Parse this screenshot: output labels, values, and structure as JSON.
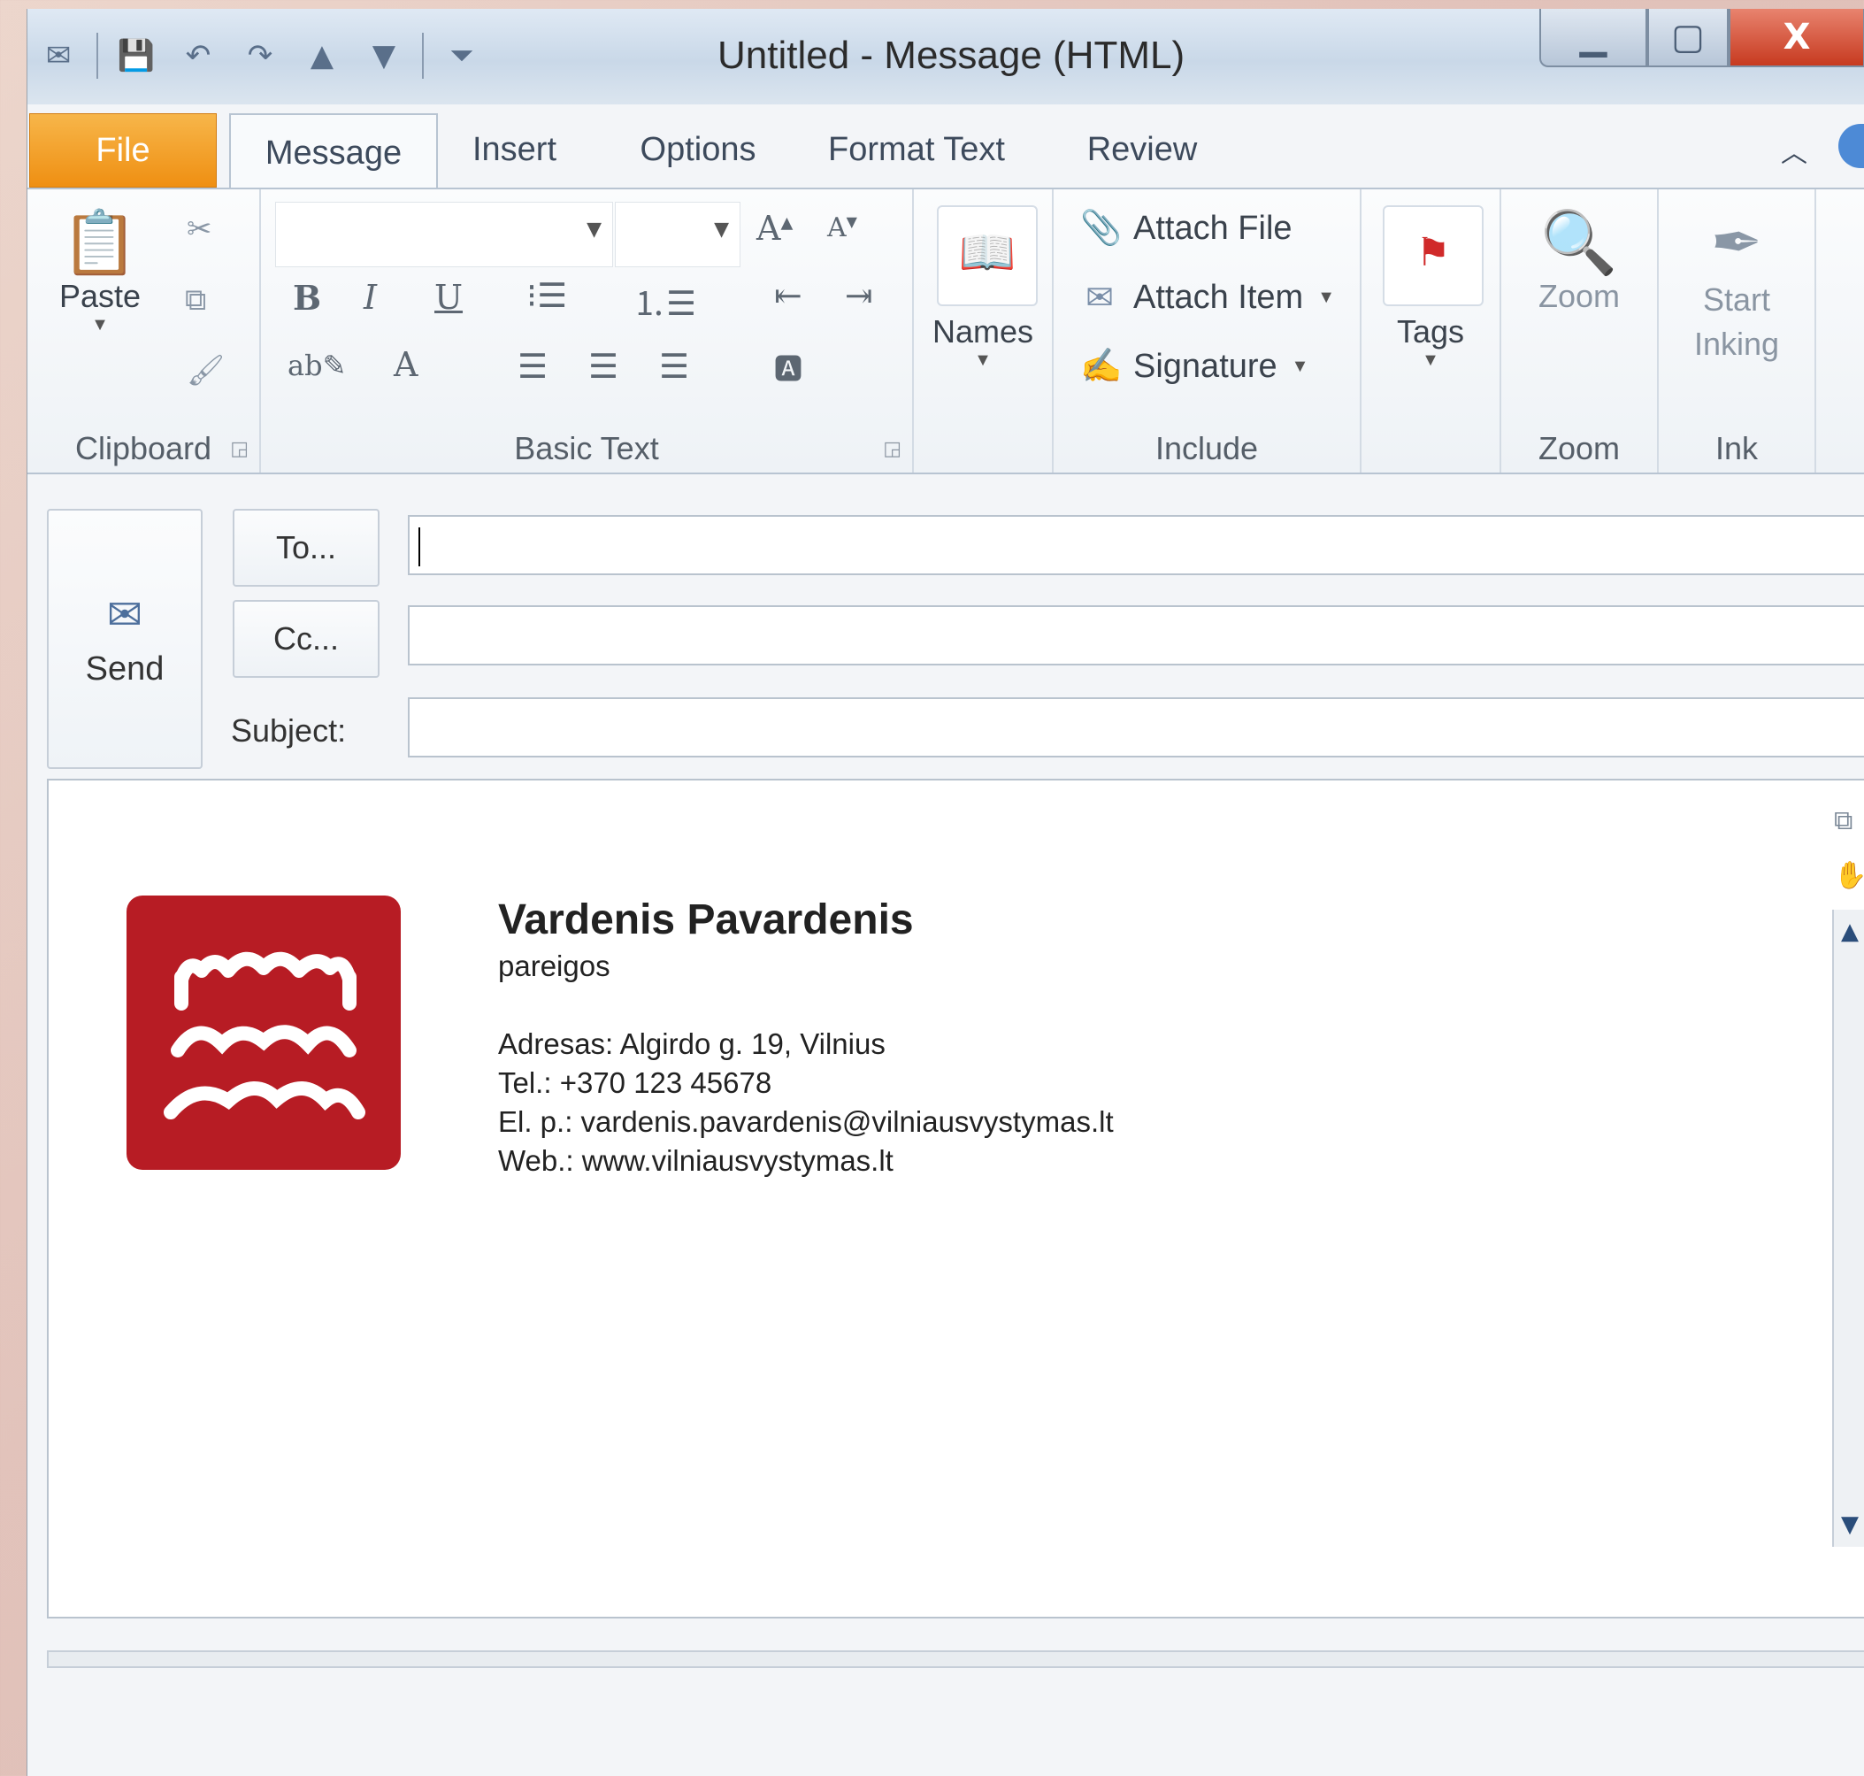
{
  "window": {
    "title": "Untitled  -  Message (HTML)",
    "close_label": "X"
  },
  "tabs": [
    "File",
    "Message",
    "Insert",
    "Options",
    "Format Text",
    "Review"
  ],
  "ribbon": {
    "clipboard": {
      "paste": "Paste",
      "label": "Clipboard"
    },
    "basic_text": {
      "label": "Basic Text",
      "bold": "B",
      "italic": "I",
      "underline": "U"
    },
    "names": {
      "label": "Names"
    },
    "include": {
      "label": "Include",
      "attach_file": "Attach File",
      "attach_item": "Attach Item",
      "signature": "Signature"
    },
    "tags": {
      "label": "Tags"
    },
    "zoom": {
      "button": "Zoom",
      "label": "Zoom"
    },
    "ink": {
      "button_line1": "Start",
      "button_line2": "Inking",
      "label": "Ink"
    }
  },
  "compose": {
    "send": "Send",
    "to": "To...",
    "cc": "Cc...",
    "subject_label": "Subject:",
    "to_value": "",
    "cc_value": "",
    "subject_value": ""
  },
  "signature": {
    "name": "Vardenis Pavardenis",
    "position": "pareigos",
    "address": "Adresas: Algirdo g. 19, Vilnius",
    "phone": "Tel.: +370 123 45678",
    "email": "El. p.: vardenis.pavardenis@vilniausvystymas.lt",
    "web": "Web.: www.vilniausvystymas.lt"
  },
  "colors": {
    "file_tab": "#ef8f12",
    "logo": "#b71c24",
    "close_button": "#c73a20"
  }
}
